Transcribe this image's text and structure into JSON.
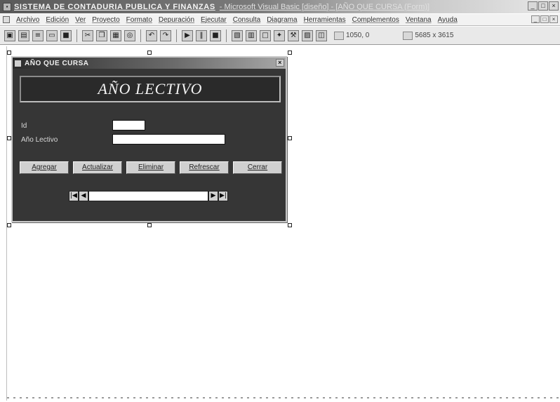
{
  "window": {
    "title_main": "SISTEMA DE CONTADURIA PUBLICA Y FINANZAS",
    "title_rest": "- Microsoft Visual Basic [diseño] - [AÑO QUE CURSA (Form)]",
    "controls": [
      "_",
      "□",
      "×"
    ]
  },
  "menu": {
    "items": [
      "Archivo",
      "Edición",
      "Ver",
      "Proyecto",
      "Formato",
      "Depuración",
      "Ejecutar",
      "Consulta",
      "Diagrama",
      "Herramientas",
      "Complementos",
      "Ventana",
      "Ayuda"
    ],
    "mdi_controls": [
      "_",
      "□",
      "×"
    ]
  },
  "toolbar": {
    "buttons": [
      "add-project",
      "add-form",
      "menu-editor",
      "open",
      "save",
      "cut",
      "copy",
      "paste",
      "find",
      "undo",
      "redo",
      "start",
      "pause",
      "stop",
      "project-explorer",
      "properties",
      "form-layout",
      "object-browser",
      "toolbox",
      "data-view",
      "component-manager"
    ],
    "position_readout": "1050, 0",
    "size_readout": "5685 x 3615"
  },
  "form": {
    "caption": "AÑO QUE CURSA",
    "banner": "AÑO LECTIVO",
    "label_id": "Id",
    "label_ano": "Año Lectivo",
    "value_id": "",
    "value_ano": "",
    "buttons": {
      "agregar": "Agregar",
      "actualizar": "Actualizar",
      "eliminar": "Eliminar",
      "refrescar": "Refrescar",
      "cerrar": "Cerrar"
    },
    "nav": {
      "first": "|◀",
      "prev": "◀",
      "next": "▶",
      "last": "▶|",
      "caption": ""
    }
  },
  "colors": {
    "form_background": "#363636",
    "titlebar_dark": "#5a5a5a"
  }
}
